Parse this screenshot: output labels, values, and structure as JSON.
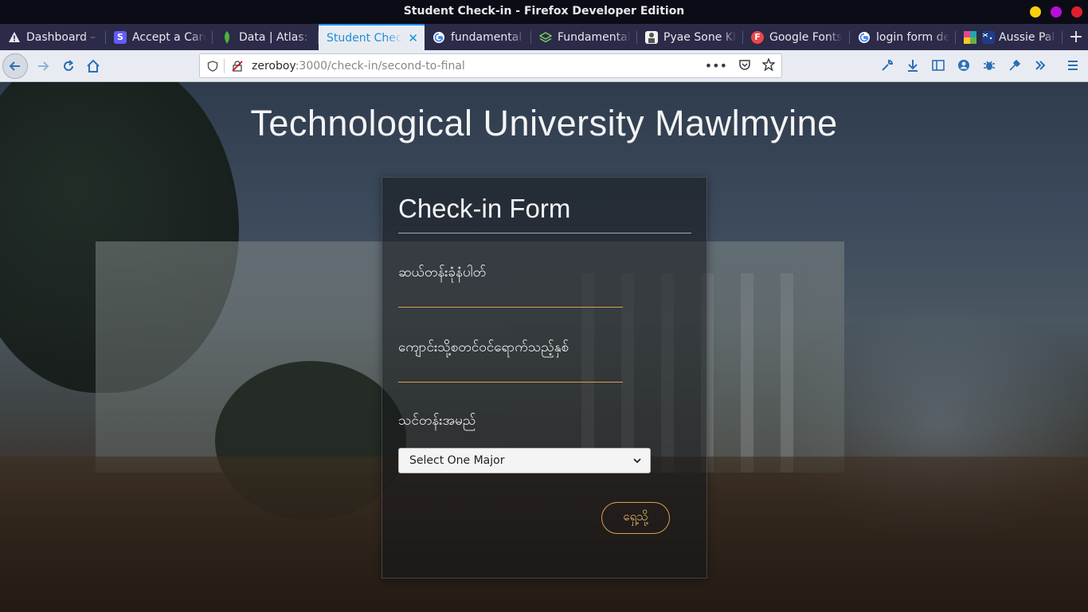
{
  "window": {
    "title": "Student Check-in - Firefox Developer Edition"
  },
  "tabs": [
    {
      "label": "Dashboard – I",
      "icon": "warning-icon"
    },
    {
      "label": "Accept a Card",
      "icon": "stripe-icon"
    },
    {
      "label": "Data | Atlas: M",
      "icon": "mongodb-leaf-icon"
    },
    {
      "label": "Student Check",
      "icon": "none",
      "active": true
    },
    {
      "label": "fundamental c",
      "icon": "google-icon"
    },
    {
      "label": "Fundamental",
      "icon": "layers-icon"
    },
    {
      "label": "Pyae Sone Kh",
      "icon": "profile-icon"
    },
    {
      "label": "Google Fonts",
      "icon": "google-fonts-icon"
    },
    {
      "label": "login form de",
      "icon": "google-icon"
    },
    {
      "label": "Aussie Pale",
      "icon": "palette-icon"
    }
  ],
  "urlbar": {
    "host": "zeroboy",
    "path": ":3000/check-in/second-to-final"
  },
  "page": {
    "heading": "Technological University Mawlmyine",
    "form": {
      "title": "Check-in Form",
      "field1_label": "ဆယ်တန်းခုံနံပါတ်",
      "field2_label": "ကျောင်းသို့စတင်ဝင်ရောက်သည့်နှစ်",
      "field3_label": "သင်တန်းအမည်",
      "select_value": "Select One Major",
      "submit_label": "ရှေ့သို့"
    }
  },
  "colors": {
    "accent": "#d9a046",
    "tab_active": "#1a8fd6"
  }
}
